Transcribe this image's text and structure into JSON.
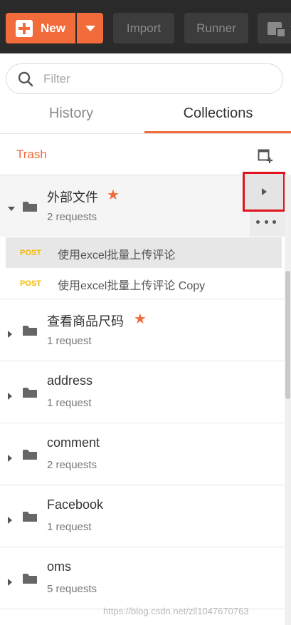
{
  "toolbar": {
    "new_label": "New",
    "import_label": "Import",
    "runner_label": "Runner"
  },
  "filter": {
    "placeholder": "Filter"
  },
  "tabs": {
    "history": "History",
    "collections": "Collections"
  },
  "trash_label": "Trash",
  "collections": [
    {
      "name": "外部文件",
      "count": "2 requests",
      "starred": true,
      "expanded": true,
      "requests": [
        {
          "method": "POST",
          "name": "使用excel批量上传评论"
        },
        {
          "method": "POST",
          "name": "使用excel批量上传评论 Copy"
        }
      ]
    },
    {
      "name": "查看商品尺码",
      "count": "1 request",
      "starred": true
    },
    {
      "name": "address",
      "count": "1 request"
    },
    {
      "name": "comment",
      "count": "2 requests"
    },
    {
      "name": "Facebook",
      "count": "1 request"
    },
    {
      "name": "oms",
      "count": "5 requests"
    }
  ],
  "watermark": "https://blog.csdn.net/zll1047670763",
  "colors": {
    "accent": "#f26b3a",
    "method_post": "#f5b800",
    "highlight_box": "#e0141e"
  }
}
